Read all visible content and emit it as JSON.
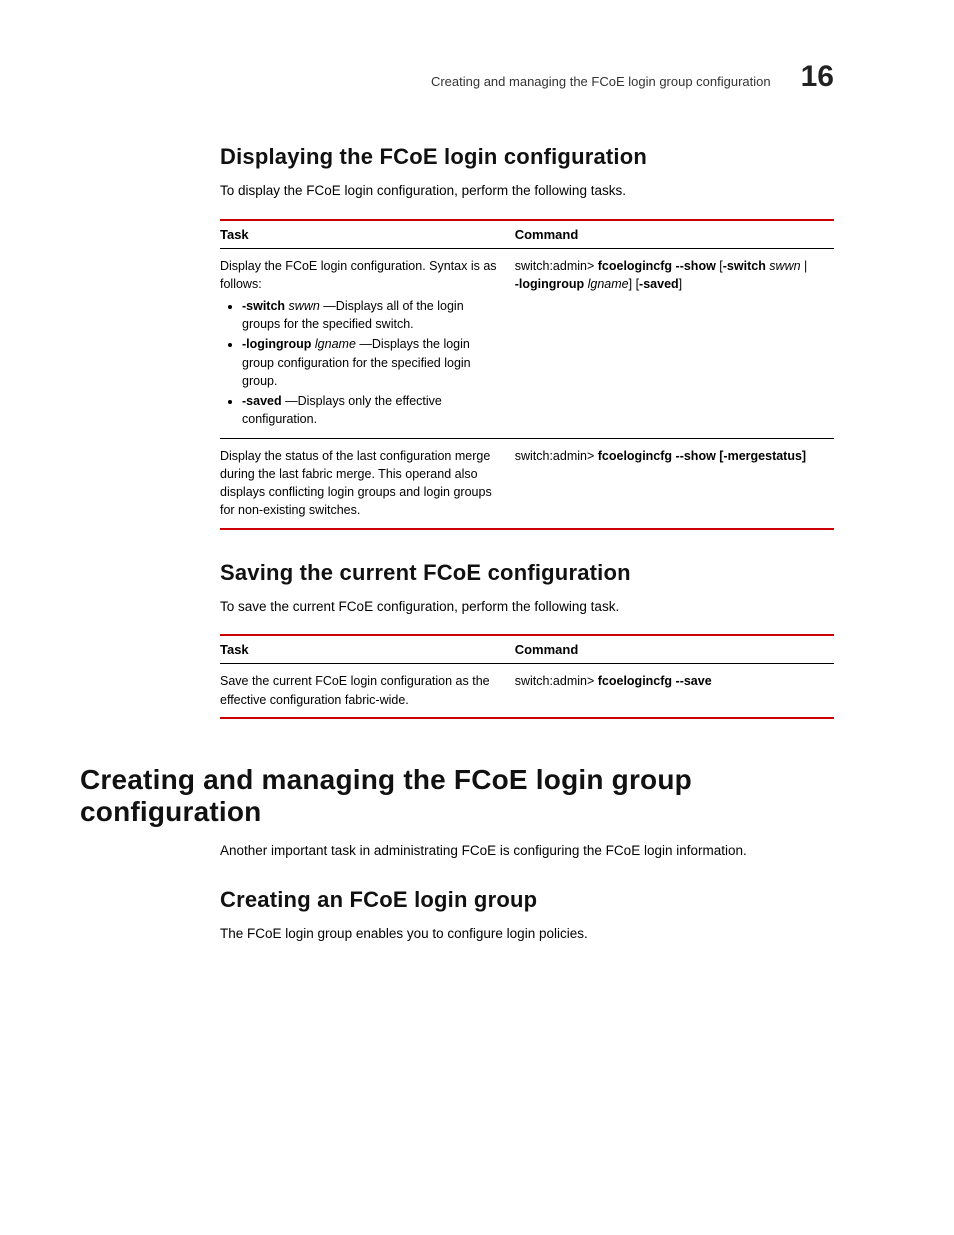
{
  "header": {
    "running_title": "Creating and managing the FCoE login group configuration",
    "chapter_number": "16"
  },
  "sec1": {
    "heading": "Displaying the FCoE login configuration",
    "intro": "To display the FCoE login configuration, perform the following tasks.",
    "table": {
      "col_task": "Task",
      "col_cmd": "Command",
      "r1": {
        "task_lead": "Display the FCoE login configuration. Syntax is as follows:",
        "b1_opt": "-switch",
        "b1_arg": "swwn",
        "b1_rest": "—Displays all of the login groups for the specified switch.",
        "b2_opt": "-logingroup",
        "b2_arg": "lgname",
        "b2_rest": "—Displays the login group configuration for the specified login group.",
        "b3_opt": "-saved",
        "b3_rest": "—Displays only the effective configuration.",
        "cmd_prefix": "switch:admin> ",
        "cmd_bold1": "fcoelogincfg --show",
        "cmd_mid1": " [",
        "cmd_bold2": "-switch",
        "cmd_arg1": " swwn",
        "cmd_mid2": " | ",
        "cmd_bold3": "-logingroup",
        "cmd_arg2": " lgname",
        "cmd_mid3": "] [",
        "cmd_bold4": "-saved",
        "cmd_end": "]"
      },
      "r2": {
        "task": "Display the status of the last configuration merge during the last fabric merge. This operand also displays conflicting login groups and login groups for non-existing switches.",
        "cmd_prefix": "switch:admin> ",
        "cmd_bold": "fcoelogincfg --show [-mergestatus]"
      }
    }
  },
  "sec2": {
    "heading": "Saving the current FCoE configuration",
    "intro": "To save the current FCoE configuration, perform the following task.",
    "table": {
      "col_task": "Task",
      "col_cmd": "Command",
      "r1": {
        "task": "Save the current FCoE login configuration as the effective configuration fabric-wide.",
        "cmd_prefix": "switch:admin> ",
        "cmd_bold": "fcoelogincfg --save"
      }
    }
  },
  "sec3": {
    "h1": "Creating and managing the FCoE login group configuration",
    "intro": "Another important task in administrating FCoE is configuring the FCoE login information.",
    "sub": {
      "heading": "Creating an FCoE login group",
      "intro": "The FCoE login group enables you to configure login policies."
    }
  }
}
